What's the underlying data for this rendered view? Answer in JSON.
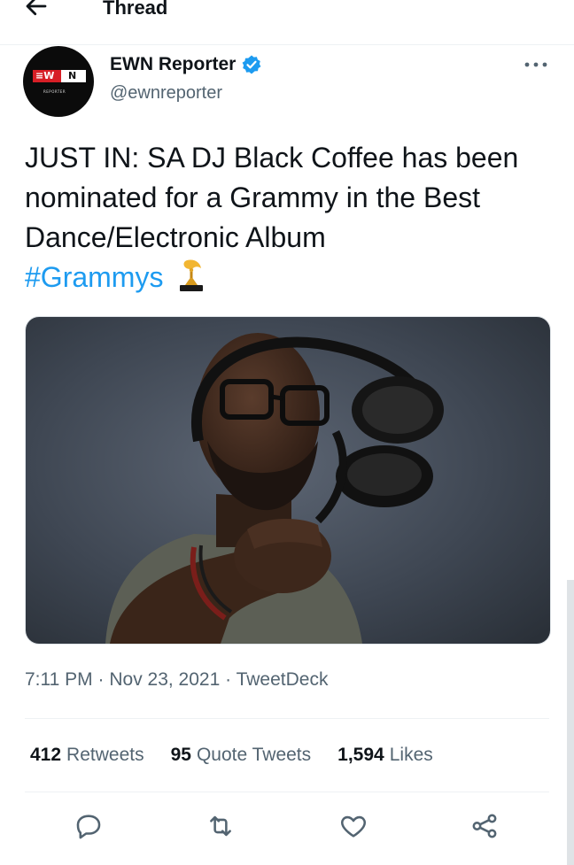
{
  "header": {
    "title": "Thread"
  },
  "author": {
    "name": "EWN Reporter",
    "handle": "@ewnreporter",
    "avatar_logo_left": "≡W",
    "avatar_logo_right": "N",
    "avatar_sub": "REPORTER",
    "verified": true
  },
  "tweet": {
    "text": "JUST IN: SA DJ Black Coffee has been nominated for a Grammy in the Best Dance/Electronic Album",
    "hashtag": "#Grammys",
    "time": "7:11 PM",
    "date": "Nov 23, 2021",
    "source": "TweetDeck",
    "meta_sep": "·"
  },
  "stats": {
    "retweets": {
      "count": "412",
      "label": "Retweets"
    },
    "quotes": {
      "count": "95",
      "label": "Quote Tweets"
    },
    "likes": {
      "count": "1,594",
      "label": "Likes"
    }
  },
  "icons": {
    "back": "arrow-left-icon",
    "verified": "verified-badge-icon",
    "more": "more-horizontal-icon",
    "emoji": "grammy-trophy-icon",
    "reply": "reply-icon",
    "retweet": "retweet-icon",
    "like": "heart-icon",
    "share": "share-icon"
  },
  "colors": {
    "accent": "#1d9bf0",
    "text_primary": "#0f1419",
    "text_secondary": "#536471",
    "brand_red": "#d71f26"
  }
}
